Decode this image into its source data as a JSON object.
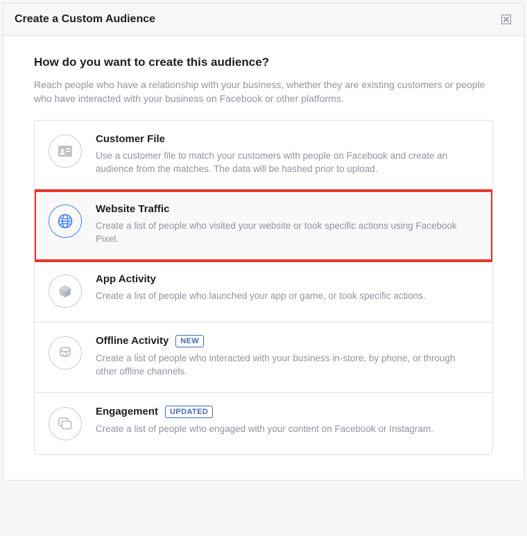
{
  "header": {
    "title": "Create a Custom Audience"
  },
  "body": {
    "question": "How do you want to create this audience?",
    "subtitle": "Reach people who have a relationship with your business, whether they are existing customers or people who have interacted with your business on Facebook or other platforms."
  },
  "options": [
    {
      "id": "customer-file",
      "title": "Customer File",
      "desc": "Use a customer file to match your customers with people on Facebook and create an audience from the matches. The data will be hashed prior to upload.",
      "badge": null,
      "selected": false
    },
    {
      "id": "website-traffic",
      "title": "Website Traffic",
      "desc": "Create a list of people who visited your website or took specific actions using Facebook Pixel.",
      "badge": null,
      "selected": true
    },
    {
      "id": "app-activity",
      "title": "App Activity",
      "desc": "Create a list of people who launched your app or game, or took specific actions.",
      "badge": null,
      "selected": false
    },
    {
      "id": "offline-activity",
      "title": "Offline Activity",
      "desc": "Create a list of people who interacted with your business in-store, by phone, or through other offline channels.",
      "badge": "NEW",
      "selected": false
    },
    {
      "id": "engagement",
      "title": "Engagement",
      "desc": "Create a list of people who engaged with your content on Facebook or Instagram.",
      "badge": "UPDATED",
      "selected": false
    }
  ]
}
